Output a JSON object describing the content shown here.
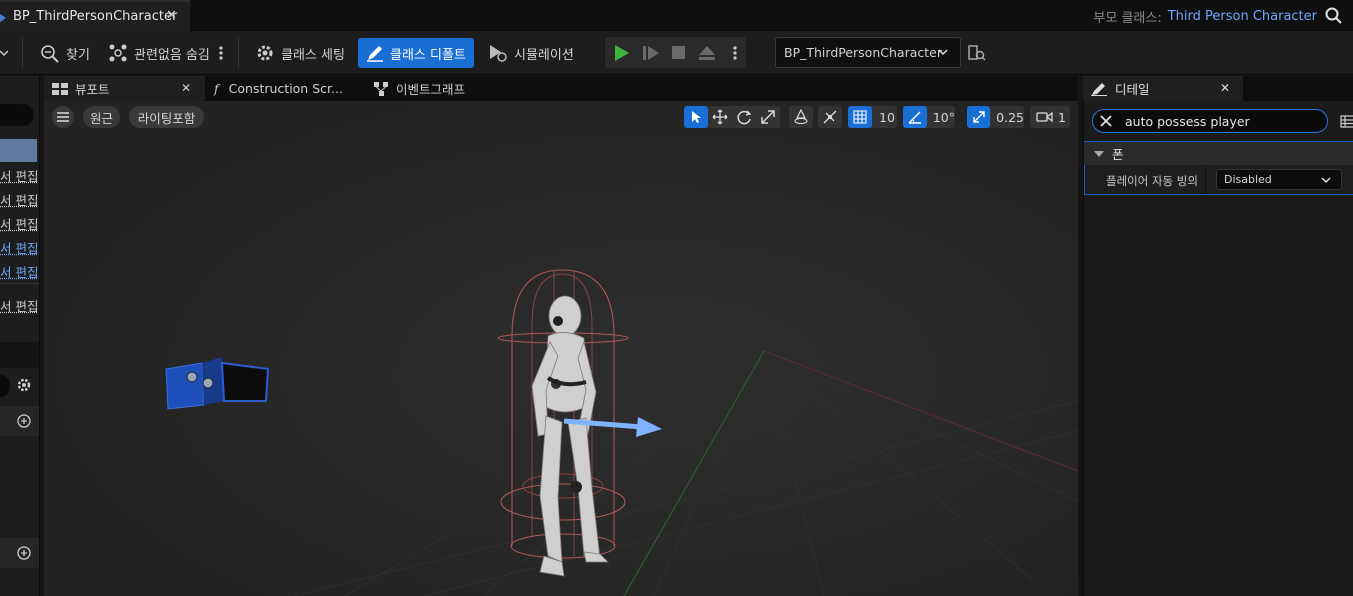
{
  "title_bar": {
    "document_tab": "BP_ThirdPersonCharacter",
    "parent_class_label": "부모 클래스:",
    "parent_class_value": "Third Person Character"
  },
  "toolbar": {
    "find": "찾기",
    "hide_unrelated": "관련없음 숨김",
    "class_settings": "클래스 세팅",
    "class_defaults": "클래스 디폴트",
    "simulation": "시뮬레이션",
    "blueprint_selector": "BP_ThirdPersonCharacter"
  },
  "left_panel": {
    "edit_items": [
      "서 편집",
      "서 편집",
      "서 편집",
      "서 편집",
      "서 편집",
      "서 편집"
    ]
  },
  "tabs": {
    "viewport": "뷰포트",
    "construction_script": "Construction Scr...",
    "event_graph": "이벤트그래프"
  },
  "viewport": {
    "perspective": "원근",
    "lighting": "라이팅포함",
    "grid_snap": "10",
    "rotation_snap": "10°",
    "scale_snap": "0.25",
    "camera_speed": "1"
  },
  "details": {
    "tab": "디테일",
    "search_value": "auto possess player",
    "category": "폰",
    "property_label": "플레이어 자동 빙의",
    "property_value": "Disabled"
  },
  "colors": {
    "accent": "#1a6fd4",
    "link": "#6ea8ff",
    "play_green": "#3fb43f",
    "capsule_outline": "#b45a5a",
    "arrow": "#7fb2ff"
  }
}
